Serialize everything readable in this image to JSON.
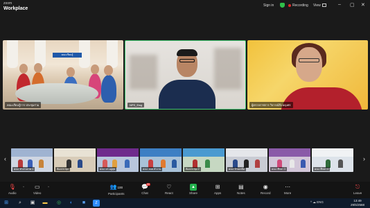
{
  "titlebar": {
    "brand_small": "zoom",
    "brand": "Workplace",
    "signin": "Sign in",
    "recording": "Recording",
    "view": "View",
    "minimize": "–",
    "maximize": "▢",
    "close": "✕"
  },
  "tiles": [
    {
      "name": "คณะเรียนรู้การ ประชุมร่วม"
    },
    {
      "name": "NPS_Ewg"
    },
    {
      "name": "ผู้ตรวจราชการ วิจารณ์สิ่ง ผดุงศร"
    }
  ],
  "tile1_banner": "คณะเรียนรู้",
  "filmstrip": [
    {
      "name": "คณะ ทำงานภาค 1"
    },
    {
      "name": "ห้องประชุม"
    },
    {
      "name": "คณะ ดร.อยู่สุข"
    },
    {
      "name": "คณะ อบต.ทำงาน"
    },
    {
      "name": "ห้องประชุม 2"
    },
    {
      "name": "คณะ บ้านเหนือ"
    },
    {
      "name": "คณะ ศึกษา 3"
    },
    {
      "name": "คณะ ศึกษา 4"
    }
  ],
  "toolbar": {
    "audio": "Audio",
    "video": "Video",
    "participants": "Participants",
    "participants_count": "100",
    "chat": "Chat",
    "chat_badge": "99",
    "react": "React",
    "share": "Share",
    "apps": "Apps",
    "notes": "Notes",
    "record": "Record",
    "more": "More",
    "leave": "Leave"
  },
  "taskbar": {
    "tray": "^ ☁ ENG",
    "time": "13:49",
    "date": "29/5/2568"
  },
  "colors": {
    "accent_green": "#23b14d",
    "recording_red": "#e02828",
    "active_speaker_border": "#3ec46d"
  }
}
